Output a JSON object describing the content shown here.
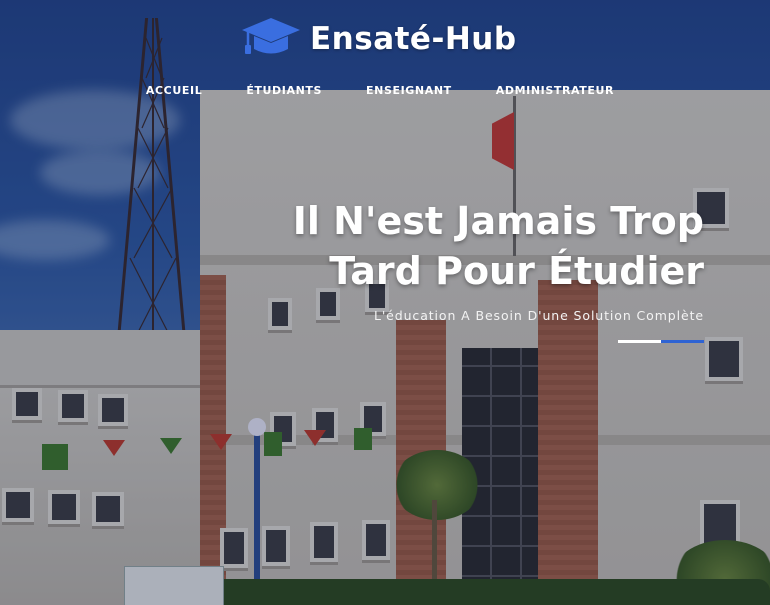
{
  "brand": {
    "title": "Ensaté-Hub",
    "icon": "graduation-cap-icon",
    "icon_color": "#3a6ee0"
  },
  "nav": {
    "items": [
      {
        "label": "ACCUEIL"
      },
      {
        "label": "ÉTUDIANTS"
      },
      {
        "label": "ENSEIGNANT"
      },
      {
        "label": "ADMINISTRATEUR"
      }
    ]
  },
  "hero": {
    "title_line1": "Il N'est Jamais Trop",
    "title_line2": "Tard Pour Étudier",
    "subtitle": "L'éducation A Besoin D'une Solution Complète"
  },
  "colors": {
    "accent": "#2f63d3",
    "text": "#ffffff"
  }
}
